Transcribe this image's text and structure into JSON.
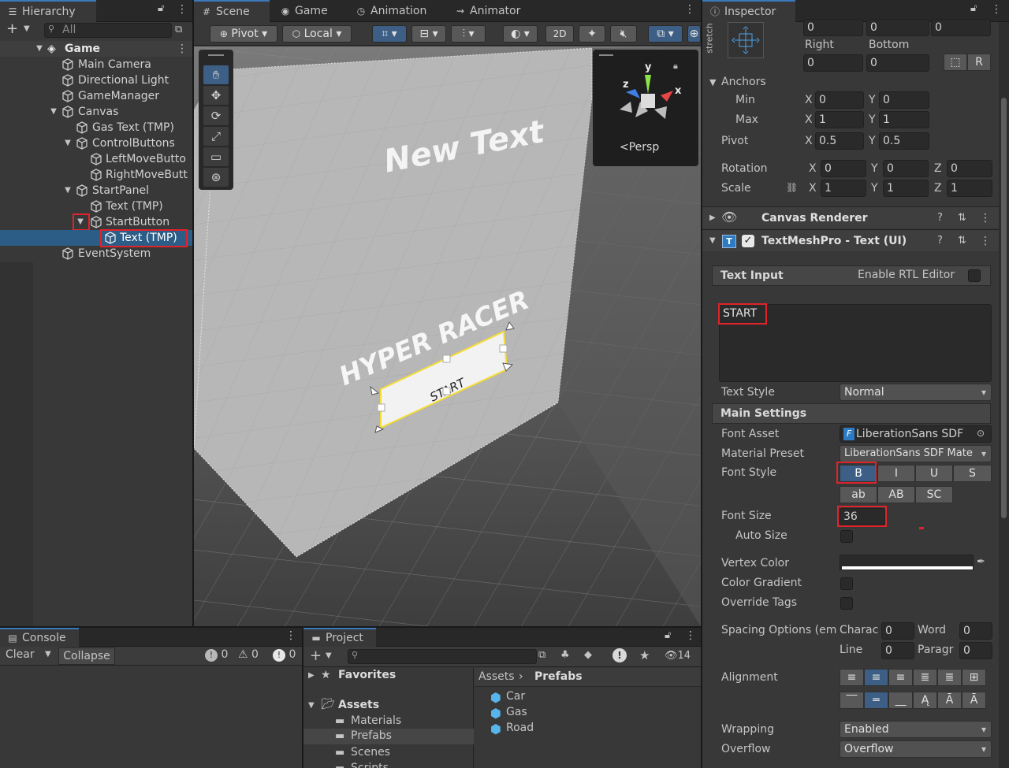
{
  "hierarchy": {
    "tab": "Hierarchy",
    "search_placeholder": "All",
    "scene": "Game",
    "items": [
      {
        "label": "Main Camera"
      },
      {
        "label": "Directional Light"
      },
      {
        "label": "GameManager"
      },
      {
        "label": "Canvas"
      },
      {
        "label": "Gas Text (TMP)"
      },
      {
        "label": "ControlButtons"
      },
      {
        "label": "LeftMoveButto"
      },
      {
        "label": "RightMoveButt"
      },
      {
        "label": "StartPanel"
      },
      {
        "label": "Text (TMP)"
      },
      {
        "label": "StartButton"
      },
      {
        "label": "Text (TMP)"
      },
      {
        "label": "EventSystem"
      }
    ]
  },
  "scene": {
    "tabs": [
      "Scene",
      "Game",
      "Animation",
      "Animator"
    ],
    "toolbar": {
      "pivot": "Pivot",
      "local": "Local",
      "mode2d": "2D"
    },
    "gizmo": {
      "y": "y",
      "x": "x",
      "z": "z",
      "persp": "Persp"
    },
    "world_text": {
      "new_text": "New Text",
      "title": "HYPER RACER",
      "button": "START"
    }
  },
  "inspector": {
    "tab": "Inspector",
    "stretch": "stretch",
    "rect_top_values": [
      "0",
      "0",
      "0"
    ],
    "right_label": "Right",
    "bottom_label": "Bottom",
    "right_value": "0",
    "bottom_value": "0",
    "anchors": {
      "label": "Anchors",
      "min": "Min",
      "max": "Max",
      "min_x": "0",
      "min_y": "0",
      "max_x": "1",
      "max_y": "1"
    },
    "pivot": {
      "label": "Pivot",
      "x": "0.5",
      "y": "0.5"
    },
    "rotation": {
      "label": "Rotation",
      "x": "0",
      "y": "0",
      "z": "0"
    },
    "scale": {
      "label": "Scale",
      "x": "1",
      "y": "1",
      "z": "1"
    },
    "axis": {
      "x": "X",
      "y": "Y",
      "z": "Z"
    },
    "canvas_renderer": "Canvas Renderer",
    "tmp_component": "TextMeshPro - Text (UI)",
    "text_input": {
      "label": "Text Input",
      "rtl": "Enable RTL Editor",
      "value": "START"
    },
    "text_style": {
      "label": "Text Style",
      "value": "Normal"
    },
    "main_settings": "Main Settings",
    "font_asset": {
      "label": "Font Asset",
      "value": "LiberationSans SDF"
    },
    "material_preset": {
      "label": "Material Preset",
      "value": "LiberationSans SDF Mate"
    },
    "font_style": {
      "label": "Font Style",
      "buttons": [
        "B",
        "I",
        "U",
        "S",
        "ab",
        "AB",
        "SC"
      ]
    },
    "font_size": {
      "label": "Font Size",
      "value": "36"
    },
    "auto_size": "Auto Size",
    "vertex_color": "Vertex Color",
    "color_gradient": "Color Gradient",
    "override_tags": "Override Tags",
    "spacing": {
      "label": "Spacing Options (em",
      "charac": "Charac",
      "word": "Word",
      "line": "Line",
      "paragr": "Paragr",
      "charac_v": "0",
      "word_v": "0",
      "line_v": "0",
      "paragr_v": "0"
    },
    "alignment": "Alignment",
    "wrapping": {
      "label": "Wrapping",
      "value": "Enabled"
    },
    "overflow": {
      "label": "Overflow",
      "value": "Overflow"
    }
  },
  "console": {
    "tab": "Console",
    "clear": "Clear",
    "collapse": "Collapse",
    "counts": [
      "0",
      "0",
      "0"
    ]
  },
  "project": {
    "tab": "Project",
    "badge_count": "14",
    "favorites": "Favorites",
    "assets": "Assets",
    "folders": [
      "Materials",
      "Prefabs",
      "Scenes",
      "Scripts"
    ],
    "breadcrumb": [
      "Assets",
      "Prefabs"
    ],
    "files": [
      "Car",
      "Gas",
      "Road"
    ]
  },
  "colors": {
    "selection": "#2c5d87",
    "accent": "#3a79bb",
    "highlight": "#e0232a"
  }
}
